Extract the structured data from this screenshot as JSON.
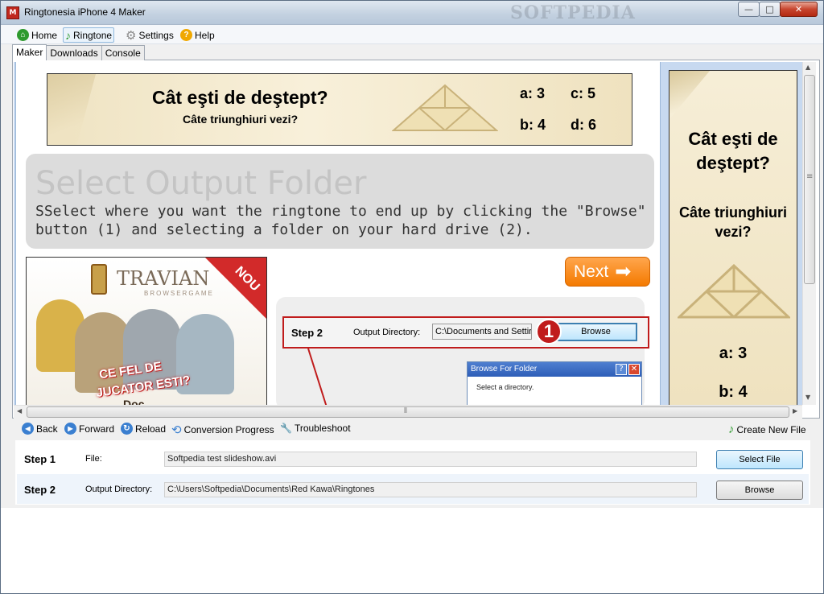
{
  "window": {
    "title": "Ringtonesia iPhone 4 Maker",
    "watermark": "SOFTPEDIA",
    "min_glyph": "—",
    "max_glyph": "□",
    "close_glyph": "✕",
    "app_icon_glyph": "M"
  },
  "menu": {
    "home": "Home",
    "ringtone": "Ringtone",
    "settings": "Settings",
    "help": "Help",
    "home_glyph": "⌂",
    "ringtone_glyph": "♪",
    "settings_glyph": "⚙",
    "help_glyph": "?"
  },
  "tabs": [
    "Maker",
    "Downloads",
    "Console"
  ],
  "banner": {
    "question": "Cât eşti de deştept?",
    "subtitle": "Câte triunghiuri vezi?",
    "a": "a: 3",
    "b": "b: 4",
    "c": "c: 5",
    "d": "d: 6"
  },
  "section": {
    "title": "Select Output Folder",
    "description": "SSelect where you want the ringtone to end up by clicking the \"Browse\" button (1) and selecting a folder on your hard drive (2)."
  },
  "ad_left": {
    "brand": "TRAVIAN",
    "brand_sub": "BROWSERGAME",
    "badge": "NOU",
    "slogan_1": "CE FEL DE",
    "slogan_2": "JUCATOR ESTI?",
    "footer": "Doc"
  },
  "next_button": {
    "label": "Next",
    "arrow": "➡"
  },
  "demo": {
    "step": "Step 2",
    "label": "Output Directory:",
    "value": "C:\\Documents and Settir",
    "marker": "1",
    "browse": "Browse",
    "dialog_title": "Browse For Folder",
    "dialog_help": "?",
    "dialog_close": "✕",
    "dialog_text": "Select a directory."
  },
  "side_ad": {
    "question_1": "Cât eşti de",
    "question_2": "deştept?",
    "subtitle_1": "Câte triunghiuri",
    "subtitle_2": "vezi?",
    "a": "a: 3",
    "b": "b: 4"
  },
  "scroll": {
    "up": "▲",
    "down": "▼",
    "left": "◀",
    "right": "▶",
    "grip": "≡",
    "hgrip": "⦀"
  },
  "nav": {
    "back": "Back",
    "forward": "Forward",
    "reload": "Reload",
    "conversion": "Conversion Progress",
    "troubleshoot": "Troubleshoot",
    "create": "Create New File",
    "back_glyph": "◀",
    "forward_glyph": "▶",
    "reload_glyph": "↻",
    "conversion_glyph": "⟲",
    "troubleshoot_glyph": "🔧",
    "create_glyph": "♪"
  },
  "steps": [
    {
      "step": "Step 1",
      "label": "File:",
      "value": "Softpedia test slideshow.avi",
      "button": "Select File"
    },
    {
      "step": "Step 2",
      "label": "Output Directory:",
      "value": "C:\\Users\\Softpedia\\Documents\\Red Kawa\\Ringtones",
      "button": "Browse"
    }
  ],
  "colors": {
    "accent_orange": "#f47a00",
    "highlight_red": "#c01c1c",
    "banner_beige": "#efe3c2"
  }
}
